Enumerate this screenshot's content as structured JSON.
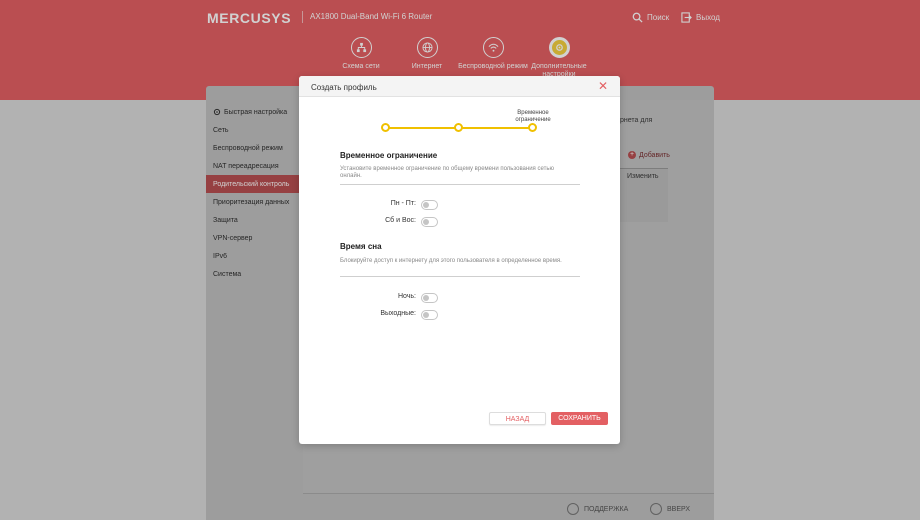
{
  "header": {
    "logo": "MERCUSYS",
    "product": "AX1800 Dual-Band Wi-Fi 6 Router",
    "search_label": "Поиск",
    "logout_label": "Выход",
    "nav": [
      {
        "label": "Схема сети",
        "icon": "network-map-icon"
      },
      {
        "label": "Интернет",
        "icon": "globe-icon"
      },
      {
        "label": "Беспроводной режим",
        "icon": "wifi-icon"
      },
      {
        "label": "Дополнительные настройки",
        "icon": "gear-icon"
      }
    ]
  },
  "sidebar": {
    "items": [
      {
        "label": "Быстрая настройка"
      },
      {
        "label": "Сеть"
      },
      {
        "label": "Беспроводной режим"
      },
      {
        "label": "NAT переадресация"
      },
      {
        "label": "Родительский контроль"
      },
      {
        "label": "Приоритезация данных"
      },
      {
        "label": "Защита"
      },
      {
        "label": "VPN-сервер"
      },
      {
        "label": "IPv6"
      },
      {
        "label": "Система"
      }
    ]
  },
  "background": {
    "partial_text": "рнета для",
    "add_label": "Добавить",
    "edit_col": "Изменить"
  },
  "footer": {
    "support": "ПОДДЕРЖКА",
    "top": "ВВЕРХ"
  },
  "modal": {
    "title": "Создать профиль",
    "step_label": "Временное ограничение",
    "time_limit": {
      "title": "Временное ограничение",
      "desc": "Установите временное ограничение по общему времени пользования сетью онлайн.",
      "weekdays_label": "Пн - Пт:",
      "weekend_label": "Сб и Вос:"
    },
    "bedtime": {
      "title": "Время сна",
      "desc": "Блокируйте доступ к интернету для этого пользователя в определенное время.",
      "night_label": "Ночь:",
      "weekend_label": "Выходные:"
    },
    "back_button": "НАЗАД",
    "save_button": "СОХРАНИТЬ"
  },
  "colors": {
    "brand": "#e36063",
    "step": "#f0c000"
  }
}
